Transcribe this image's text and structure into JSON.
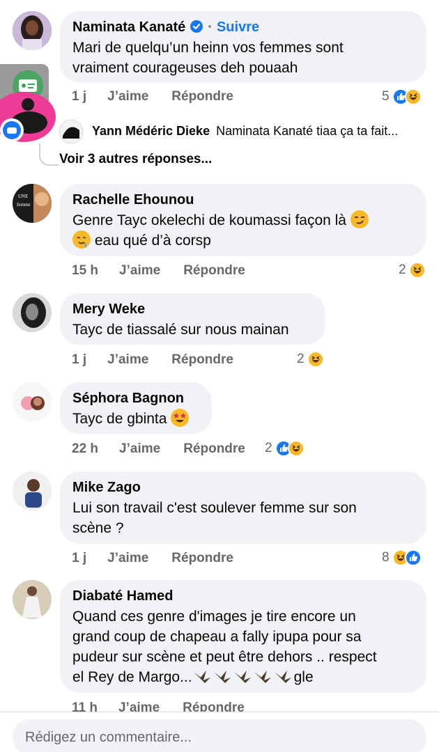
{
  "comments": [
    {
      "name": "Naminata Kanaté",
      "follow": "Suivre",
      "text_lines": [
        "Mari de quelqu’un heinn vos femmes sont",
        "vraiment courageuses deh pouaah"
      ],
      "time": "1 j",
      "like": "J’aime",
      "reply": "Répondre",
      "reaction_count": "5"
    },
    {
      "name": "Rachelle Ehounou",
      "text_line1": "Genre Tayc okelechi de koumassi façon là",
      "text_line2": "eau qué d’à corsp",
      "time": "15 h",
      "like": "J’aime",
      "reply": "Répondre",
      "reaction_count": "2"
    },
    {
      "name": "Mery Weke",
      "text": "Tayc de tiassalé sur nous mainan",
      "time": "1 j",
      "like": "J’aime",
      "reply": "Répondre",
      "reaction_count": "2"
    },
    {
      "name": "Séphora Bagnon",
      "text": "Tayc de gbinta",
      "time": "22 h",
      "like": "J’aime",
      "reply": "Répondre",
      "reaction_count": "2"
    },
    {
      "name": "Mike Zago",
      "text_lines": [
        "Lui son travail c'est soulever femme sur son",
        "scène ?"
      ],
      "time": "1 j",
      "like": "J’aime",
      "reply": "Répondre",
      "reaction_count": "8"
    },
    {
      "name": "Diabaté Hamed",
      "text_lines": [
        "Quand ces genre d'images  je tire encore un",
        "grand coup de chapeau a fally ipupa pour sa",
        "pudeur sur scène et peut être dehors .. respect"
      ],
      "text_last_prefix": "el Rey de Margo...",
      "text_last_suffix": "gle",
      "time": "11 h",
      "like": "J’aime",
      "reply": "Répondre"
    }
  ],
  "reply_preview": {
    "name": "Yann Médéric Dieke",
    "text": "Naminata Kanaté tiaa ça ta fait..."
  },
  "more_replies": "Voir 3 autres réponses...",
  "composer": {
    "placeholder": "Rédigez un commentaire..."
  },
  "colors": {
    "accent": "#1877f2",
    "bubble": "#f0f2f5",
    "meta": "#65676b",
    "haha": "#f7b928"
  }
}
